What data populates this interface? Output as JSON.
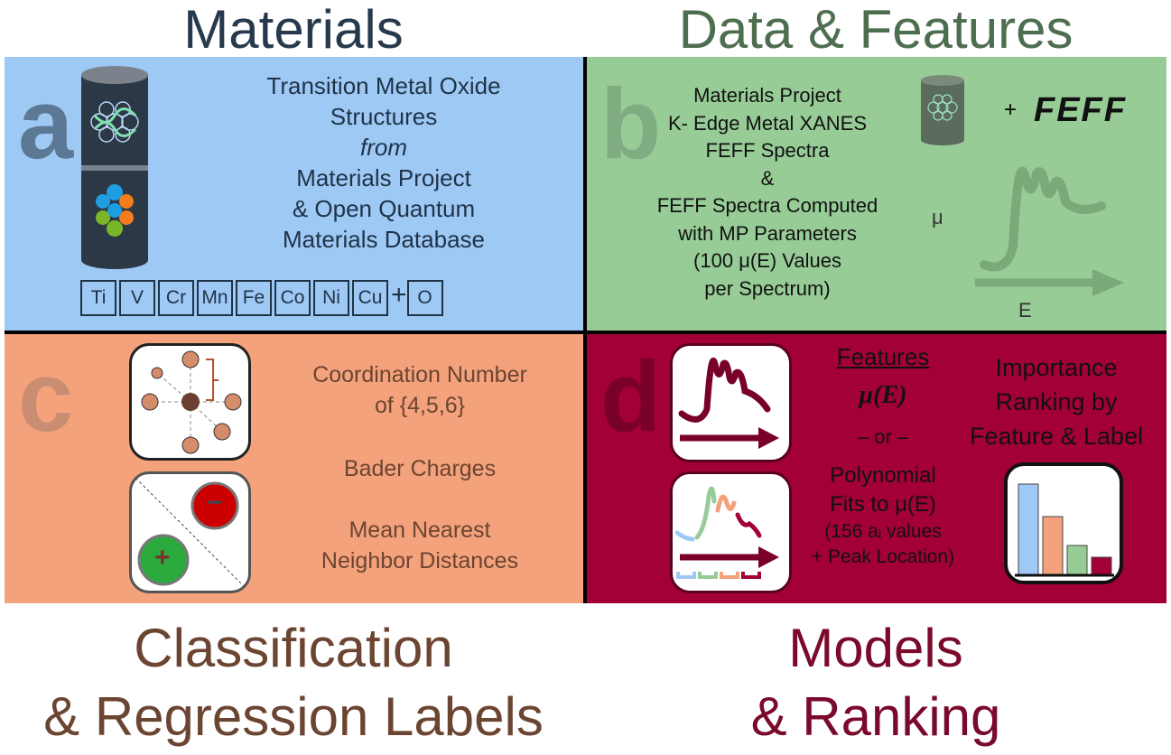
{
  "titles": {
    "materials": "Materials",
    "data": "Data & Features",
    "labels1": "Classification",
    "labels2": "& Regression Labels",
    "models1": "Models",
    "models2": "& Ranking"
  },
  "panel_a": {
    "letter": "a",
    "lines": [
      "Transition Metal Oxide",
      "Structures",
      "from",
      "Materials Project",
      "& Open Quantum",
      "Materials Database"
    ],
    "elements": [
      "Ti",
      "V",
      "Cr",
      "Mn",
      "Fe",
      "Co",
      "Ni",
      "Cu"
    ],
    "plus": "+",
    "oxygen": "O"
  },
  "panel_b": {
    "letter": "b",
    "lines": [
      "Materials Project",
      "K- Edge Metal XANES",
      "FEFF Spectra",
      "&",
      "FEFF Spectra Computed",
      "with MP Parameters",
      "(100 μ(E) Values",
      "per Spectrum)"
    ],
    "plus": "+",
    "feff_logo": "FEFF",
    "y_axis": "μ",
    "x_axis": "E"
  },
  "panel_c": {
    "letter": "c",
    "lines": [
      "Coordination Number",
      "of {4,5,6}",
      "Bader Charges",
      "Mean Nearest",
      "Neighbor Distances"
    ],
    "minus": "−",
    "plus": "+"
  },
  "panel_d": {
    "letter": "d",
    "features_heading": "Features",
    "mu": "μ(E)",
    "or": "– or –",
    "poly": [
      "Polynomial",
      "Fits to μ(E)",
      "(156 aᵢ values",
      "+ Peak Location)"
    ],
    "ranking": [
      "Importance",
      "Ranking by",
      "Feature & Label"
    ]
  },
  "colors": {
    "a": "#9ec9f5",
    "b": "#97cc97",
    "c": "#f4a27c",
    "d": "#a30036",
    "bars": [
      "#9ec9f5",
      "#f4a27c",
      "#97cc97",
      "#a30036"
    ]
  }
}
